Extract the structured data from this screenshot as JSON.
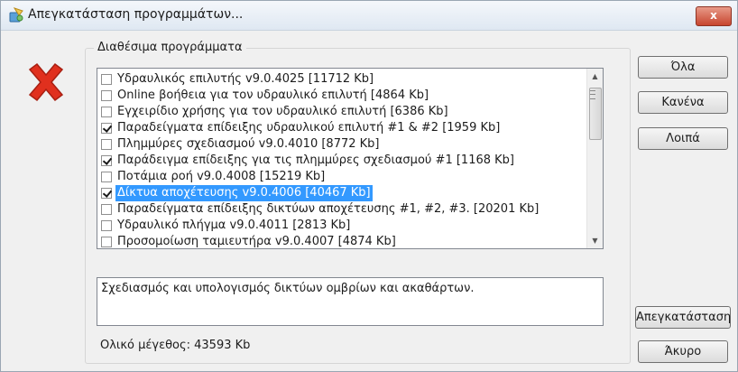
{
  "window": {
    "title": "Απεγκατάσταση προγραμμάτων...",
    "close_label": "x"
  },
  "group": {
    "label": "Διαθέσιμα προγράμματα"
  },
  "programs": [
    {
      "label": "Υδραυλικός επιλυτής v9.0.4025 [11712 Kb]",
      "checked": false,
      "selected": false
    },
    {
      "label": "Online βοήθεια για τον υδραυλικό επιλυτή [4864 Kb]",
      "checked": false,
      "selected": false
    },
    {
      "label": "Εγχειρίδιο χρήσης για τον υδραυλικό επιλυτή [6386 Kb]",
      "checked": false,
      "selected": false
    },
    {
      "label": "Παραδείγματα επίδειξης υδραυλικού επιλυτή #1 & #2 [1959 Kb]",
      "checked": true,
      "selected": false
    },
    {
      "label": "Πλημμύρες σχεδιασμού v9.0.4010 [8772 Kb]",
      "checked": false,
      "selected": false
    },
    {
      "label": "Παράδειγμα επίδειξης για τις πλημμύρες σχεδιασμού #1 [1168 Kb]",
      "checked": true,
      "selected": false
    },
    {
      "label": "Ποτάμια ροή v9.0.4008 [15219 Kb]",
      "checked": false,
      "selected": false
    },
    {
      "label": "Δίκτυα αποχέτευσης v9.0.4006 [40467 Kb]",
      "checked": true,
      "selected": true
    },
    {
      "label": "Παραδείγματα επίδειξης δικτύων αποχέτευσης #1, #2, #3. [20201 Kb]",
      "checked": false,
      "selected": false
    },
    {
      "label": "Υδραυλικό πλήγμα v9.0.4011 [2813 Kb]",
      "checked": false,
      "selected": false
    },
    {
      "label": "Προσομοίωση ταμιευτήρα v9.0.4007 [4874 Kb]",
      "checked": false,
      "selected": false
    }
  ],
  "description": "Σχεδιασμός και υπολογισμός δικτύων ομβρίων και ακαθάρτων.",
  "total": "Ολικό μέγεθος: 43593 Kb",
  "buttons": {
    "all": "Όλα",
    "none": "Κανένα",
    "rest": "Λοιπά",
    "uninstall": "Απεγκατάσταση",
    "cancel": "Άκυρο"
  },
  "icons": {
    "window": "uninstall-icon",
    "status": "red-x-icon"
  },
  "colors": {
    "selection": "#3399ff",
    "red_x": "#e0301e"
  }
}
